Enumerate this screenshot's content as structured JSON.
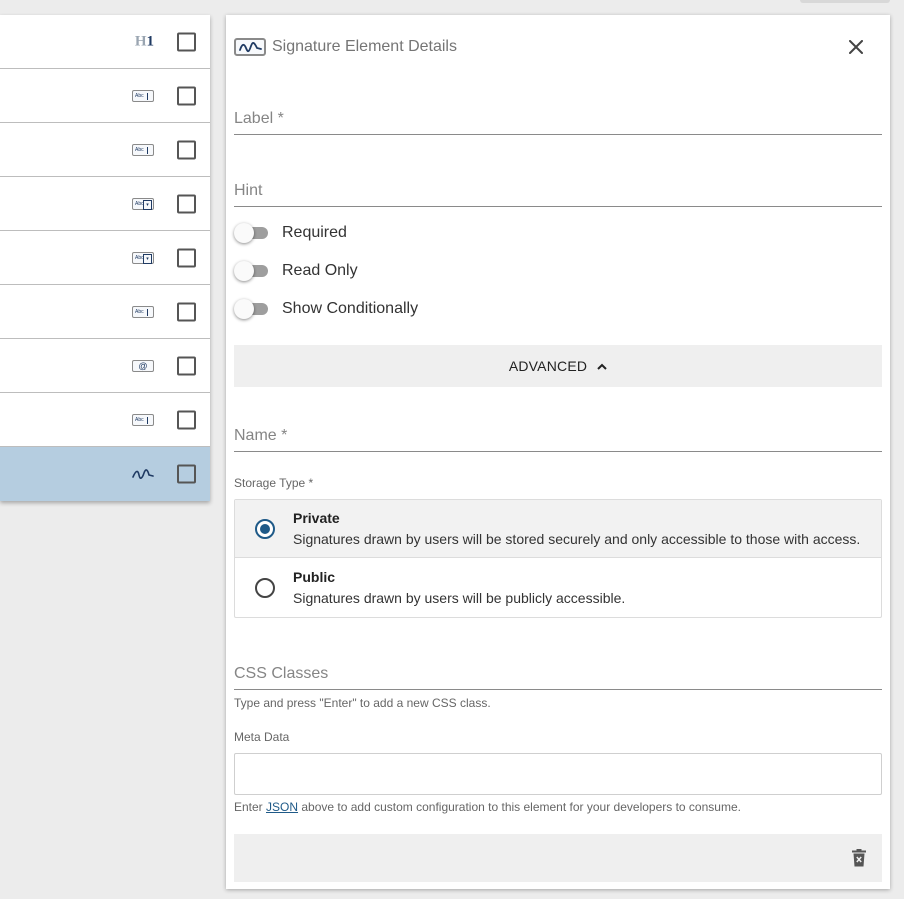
{
  "left_list": {
    "rows": [
      {
        "icon": "heading-icon",
        "icon_text_h": "H",
        "icon_text_1": "1",
        "selected": false
      },
      {
        "icon": "text-field-icon",
        "mini": "Abc",
        "selected": false
      },
      {
        "icon": "text-field-icon",
        "mini": "Abc",
        "selected": false
      },
      {
        "icon": "dropdown-field-icon",
        "mini": "Abc",
        "dd": "▾",
        "selected": false
      },
      {
        "icon": "dropdown-field-icon",
        "mini": "Abc",
        "dd": "▾",
        "selected": false
      },
      {
        "icon": "text-field-icon",
        "mini": "Abc",
        "selected": false
      },
      {
        "icon": "email-field-icon",
        "mini": "@",
        "selected": false
      },
      {
        "icon": "text-field-icon",
        "mini": "Abc",
        "selected": false
      },
      {
        "icon": "signature-icon",
        "selected": true
      }
    ],
    "selected_color": "#b5cde0"
  },
  "panel": {
    "title": "Signature Element Details",
    "close_icon": "close-icon",
    "label_field": "Label *",
    "hint_field": "Hint",
    "toggles": {
      "required": "Required",
      "read_only": "Read Only",
      "show_conditionally": "Show Conditionally"
    },
    "advanced_label": "ADVANCED",
    "name_field": "Name *",
    "storage_type_label": "Storage Type *",
    "storage_options": {
      "private_title": "Private",
      "private_desc": "Signatures drawn by users will be stored securely and only accessible to those with access.",
      "public_title": "Public",
      "public_desc": "Signatures drawn by users will be publicly accessible."
    },
    "css_classes_field": "CSS Classes",
    "css_hint": "Type and press \"Enter\" to add a new CSS class.",
    "meta_data_label": "Meta Data",
    "meta_hint_before": "Enter ",
    "meta_hint_link": "JSON",
    "meta_hint_after": " above to add custom configuration to this element for your developers to consume.",
    "accent_color": "#1f5a88"
  }
}
